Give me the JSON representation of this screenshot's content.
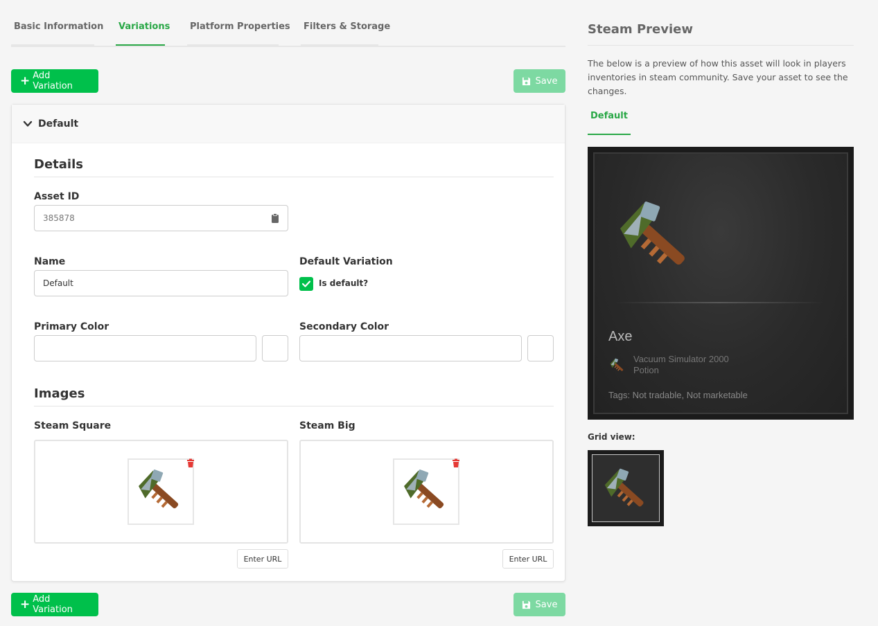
{
  "tabs": [
    {
      "label": "Basic Information"
    },
    {
      "label": "Variations"
    },
    {
      "label": "Platform Properties"
    },
    {
      "label": "Filters & Storage"
    }
  ],
  "actions": {
    "add_variation": "Add Variation",
    "save": "Save"
  },
  "variation": {
    "header": "Default",
    "details_title": "Details",
    "asset_id": {
      "label": "Asset ID",
      "value": "385878"
    },
    "name": {
      "label": "Name",
      "value": "Default"
    },
    "default_variation": {
      "label": "Default Variation",
      "checkbox_label": "Is default?",
      "checked": true
    },
    "primary_color": {
      "label": "Primary Color",
      "value": ""
    },
    "secondary_color": {
      "label": "Secondary Color",
      "value": ""
    },
    "images_title": "Images",
    "steam_square": {
      "label": "Steam Square",
      "url_button": "Enter URL"
    },
    "steam_big": {
      "label": "Steam Big",
      "url_button": "Enter URL"
    }
  },
  "preview": {
    "title": "Steam Preview",
    "description": "The below is a preview of how this asset will look in players inventories in steam community. Save your asset to see the changes.",
    "tab": "Default",
    "item_name": "Axe",
    "game_name": "Vacuum Simulator 2000",
    "item_type": "Potion",
    "tags": "Tags: Not tradable, Not marketable",
    "grid_label": "Grid view:"
  },
  "colors": {
    "accent": "#00c04b",
    "save_disabled": "#7dd9a2",
    "tab_active": "#28a745",
    "trash": "#e53935"
  },
  "icons": [
    "plus-icon",
    "save-icon",
    "chevron-down-icon",
    "clipboard-icon",
    "check-icon",
    "trash-icon",
    "axe-icon"
  ]
}
